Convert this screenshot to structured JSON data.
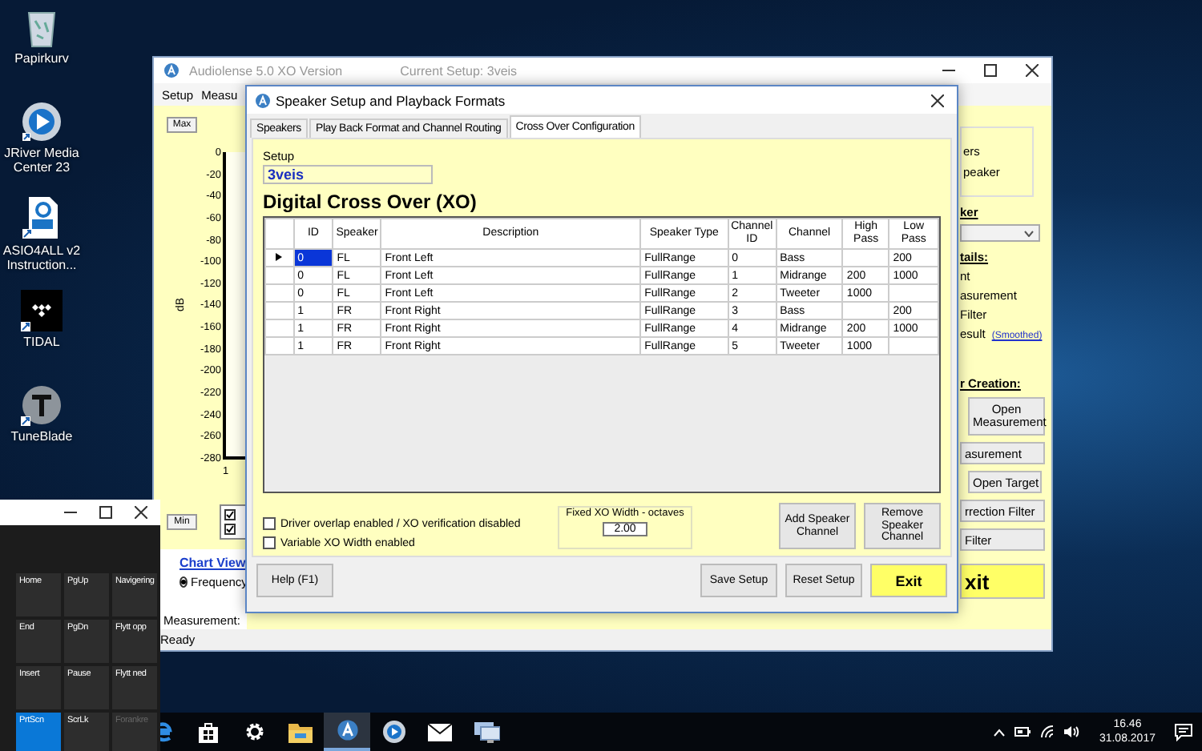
{
  "desktop_icons": [
    {
      "kind": "trash",
      "label": "Papirkurv"
    },
    {
      "kind": "disc",
      "label": "JRiver Media Center 23"
    },
    {
      "kind": "pdf",
      "label": "ASIO4ALL v2 Instruction..."
    },
    {
      "kind": "dots",
      "label": "TIDAL"
    },
    {
      "kind": "tee",
      "label": "TuneBlade"
    }
  ],
  "main_window": {
    "title": "Audiolense 5.0 XO Version",
    "current_setup": "Current Setup: 3veis",
    "menu": [
      "Setup",
      "Measu"
    ],
    "chart": {
      "max_button": "Max",
      "min_button": "Min",
      "y_axis_label": "dB",
      "y_ticks": [
        "0",
        "-20",
        "-40",
        "-60",
        "-80",
        "-100",
        "-120",
        "-140",
        "-160",
        "-180",
        "-200",
        "-220",
        "-240",
        "-260",
        "-280"
      ],
      "x_tick": "1"
    },
    "chart_checks": [
      {
        "checked": true
      },
      {
        "checked": true
      }
    ],
    "chart_view": {
      "title": "Chart View",
      "options": [
        {
          "label": "Frequency",
          "selected": true
        }
      ]
    },
    "measurement_label": "Measurement:",
    "right_panel": [
      {
        "kind": "group",
        "lines": [
          "ers",
          "peaker"
        ]
      },
      {
        "kind": "heading",
        "text": "ker"
      },
      {
        "kind": "dropdown"
      },
      {
        "kind": "heading",
        "text": "tails:"
      },
      {
        "kind": "text",
        "text": "nt"
      },
      {
        "kind": "text",
        "text": "asurement"
      },
      {
        "kind": "text",
        "text": "Filter"
      },
      {
        "kind": "text",
        "text": "esult",
        "link": "(Smoothed)"
      },
      {
        "kind": "heading",
        "text": "r Creation:"
      },
      {
        "kind": "button",
        "text": "Open Measurement"
      },
      {
        "kind": "button",
        "text": "asurement"
      },
      {
        "kind": "button",
        "text": "Open Target"
      },
      {
        "kind": "button",
        "text": "rrection Filter"
      },
      {
        "kind": "button",
        "text": "Filter"
      },
      {
        "kind": "exit",
        "text": "xit"
      }
    ],
    "status": "Ready"
  },
  "dialog": {
    "title": "Speaker Setup and Playback Formats",
    "tabs": [
      {
        "label": "Speakers",
        "selected": false
      },
      {
        "label": "Play Back Format and Channel Routing",
        "selected": false
      },
      {
        "label": "Cross Over Configuration",
        "selected": true
      }
    ],
    "setup_label": "Setup",
    "setup_value": "3veis",
    "heading": "Digital Cross Over (XO)",
    "table": {
      "columns": [
        "ID",
        "Speaker",
        "Description",
        "Speaker Type",
        "Channel ID",
        "Channel",
        "High Pass",
        "Low Pass"
      ],
      "rows": [
        {
          "selected": true,
          "cells": [
            "0",
            "FL",
            "Front Left",
            "FullRange",
            "0",
            "Bass",
            null,
            "200"
          ]
        },
        {
          "selected": false,
          "cells": [
            "0",
            "FL",
            "Front Left",
            "FullRange",
            "1",
            "Midrange",
            "200",
            "1000"
          ]
        },
        {
          "selected": false,
          "cells": [
            "0",
            "FL",
            "Front Left",
            "FullRange",
            "2",
            "Tweeter",
            "1000",
            null
          ]
        },
        {
          "selected": false,
          "cells": [
            "1",
            "FR",
            "Front Right",
            "FullRange",
            "3",
            "Bass",
            null,
            "200"
          ]
        },
        {
          "selected": false,
          "cells": [
            "1",
            "FR",
            "Front Right",
            "FullRange",
            "4",
            "Midrange",
            "200",
            "1000"
          ]
        },
        {
          "selected": false,
          "cells": [
            "1",
            "FR",
            "Front Right",
            "FullRange",
            "5",
            "Tweeter",
            "1000",
            null
          ]
        }
      ]
    },
    "options": [
      {
        "label": "Driver overlap enabled / XO verification disabled",
        "checked": false
      },
      {
        "label": "Variable XO Width enabled",
        "checked": false
      }
    ],
    "fixed_width": {
      "label": "Fixed XO Width - octaves",
      "value": "2.00"
    },
    "side_buttons": [
      "Add Speaker Channel",
      "Remove Speaker Channel"
    ],
    "footer_buttons": [
      {
        "kind": "help",
        "label": "Help (F1)"
      },
      {
        "kind": "plain",
        "label": "Save Setup"
      },
      {
        "kind": "plain",
        "label": "Reset Setup"
      },
      {
        "kind": "primary",
        "label": "Exit"
      }
    ]
  },
  "keyboard": {
    "keys": [
      {
        "label": "Home",
        "selected": false,
        "disabled": false
      },
      {
        "label": "PgUp",
        "selected": false,
        "disabled": false
      },
      {
        "label": "Navigering",
        "selected": false,
        "disabled": false
      },
      {
        "label": "End",
        "selected": false,
        "disabled": false
      },
      {
        "label": "PgDn",
        "selected": false,
        "disabled": false
      },
      {
        "label": "Flytt opp",
        "selected": false,
        "disabled": false
      },
      {
        "label": "Insert",
        "selected": false,
        "disabled": false
      },
      {
        "label": "Pause",
        "selected": false,
        "disabled": false
      },
      {
        "label": "Flytt ned",
        "selected": false,
        "disabled": false
      },
      {
        "label": "PrtScn",
        "selected": true,
        "disabled": false
      },
      {
        "label": "ScrLk",
        "selected": false,
        "disabled": false
      },
      {
        "label": "Forankre",
        "selected": false,
        "disabled": true
      }
    ]
  },
  "taskbar": {
    "apps": [
      {
        "kind": "edge",
        "selected": false
      },
      {
        "kind": "store",
        "selected": false
      },
      {
        "kind": "settings",
        "selected": false
      },
      {
        "kind": "folder",
        "selected": false
      },
      {
        "kind": "audiolense",
        "selected": true
      },
      {
        "kind": "jriver",
        "selected": false
      },
      {
        "kind": "mail",
        "selected": false
      },
      {
        "kind": "network",
        "selected": false
      }
    ],
    "time": "16.46",
    "date": "31.08.2017"
  }
}
